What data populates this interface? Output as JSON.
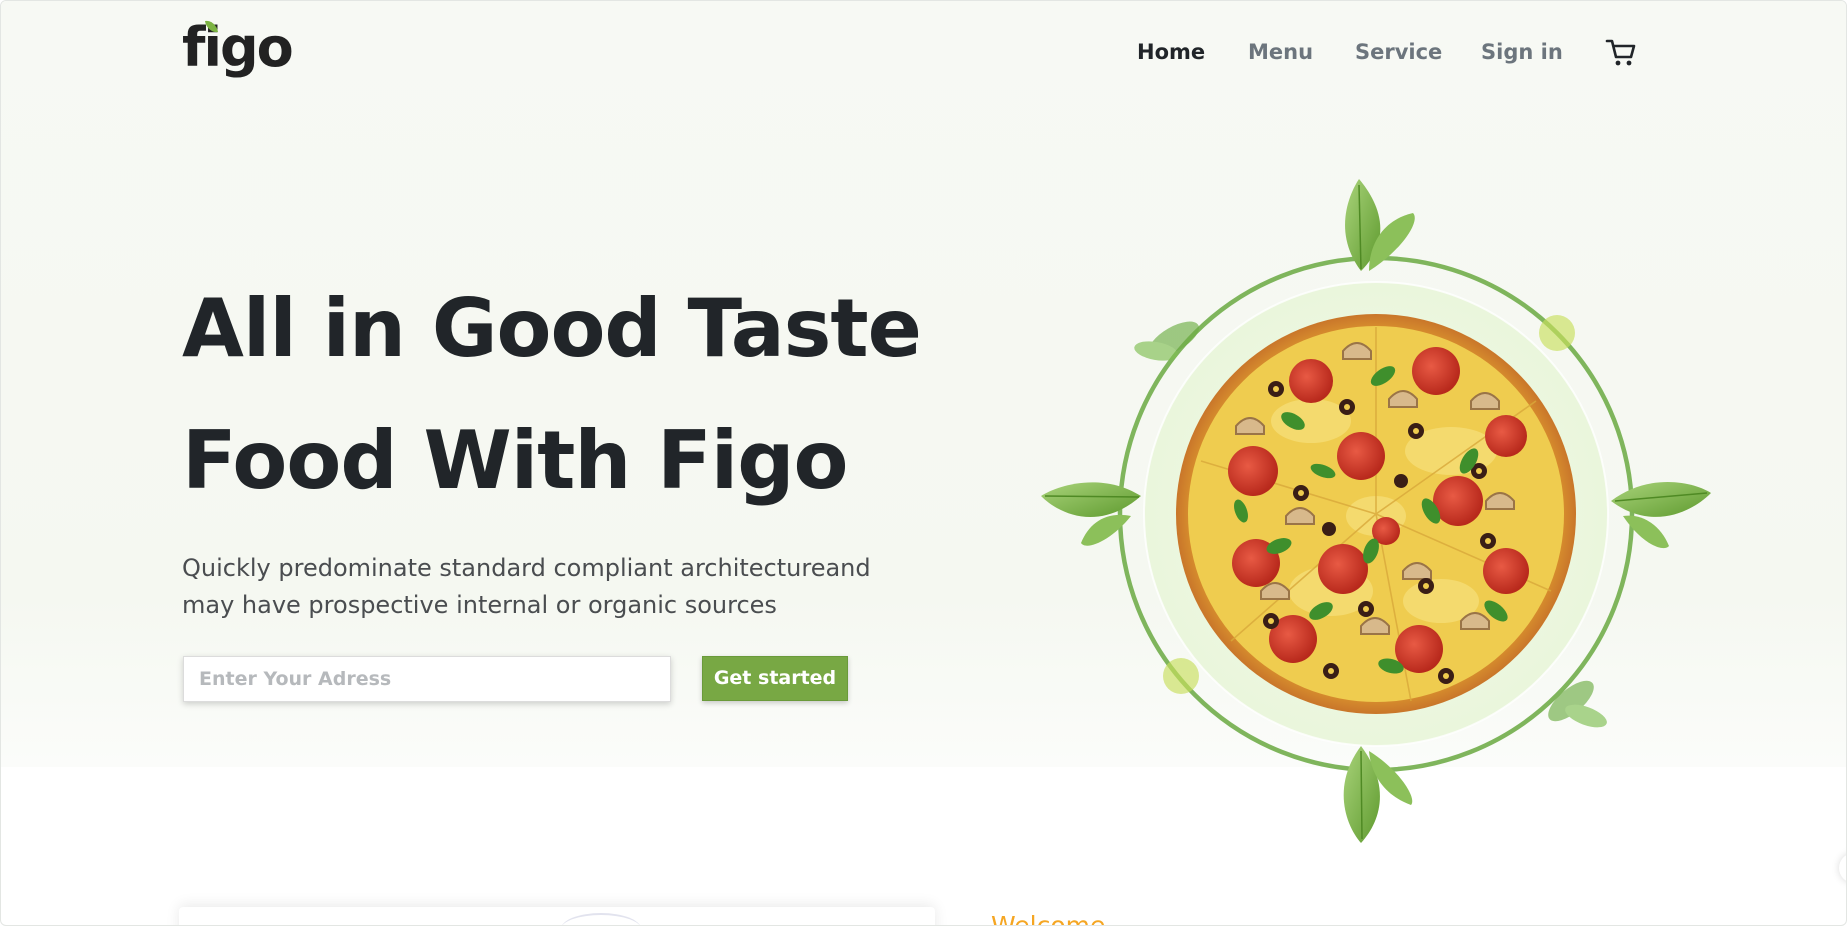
{
  "header": {
    "logo_text": "figo",
    "nav": [
      {
        "label": "Home",
        "active": true
      },
      {
        "label": "Menu",
        "active": false
      },
      {
        "label": "Service",
        "active": false
      },
      {
        "label": "Sign in",
        "active": false
      }
    ],
    "cart_icon": "shopping-cart-icon"
  },
  "hero": {
    "title_line1": "All in Good Taste",
    "title_line2": "Food With Figo",
    "subtitle_line1": "Quickly predominate standard compliant architectureand",
    "subtitle_line2": "may have prospective internal or organic sources",
    "address_placeholder": "Enter Your Adress",
    "cta_label": "Get started",
    "image": "pizza-with-basil-leaves"
  },
  "about": {
    "welcome_label": "Welcome"
  },
  "colors": {
    "accent": "#78a844",
    "text_dark": "#212529",
    "text_muted": "#6c757d",
    "welcome": "#f5a623",
    "hero_bg": "#f6f8f3"
  }
}
